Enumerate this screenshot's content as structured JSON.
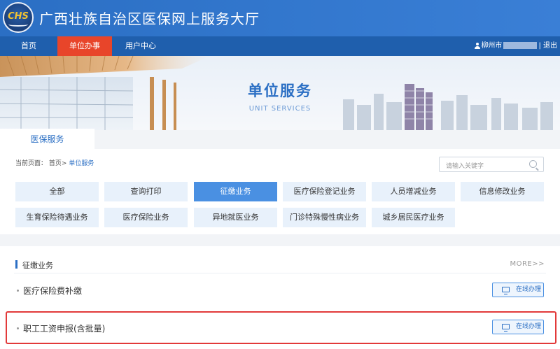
{
  "header": {
    "logo_text": "CHS",
    "title": "广西壮族自治区医保网上服务大厅"
  },
  "nav": {
    "items": [
      {
        "label": "首页"
      },
      {
        "label": "单位办事"
      },
      {
        "label": "用户中心"
      }
    ],
    "user_city": "柳州市",
    "separator": "|",
    "logout": "退出"
  },
  "banner": {
    "title": "单位服务",
    "subtitle": "UNIT SERVICES"
  },
  "tab": {
    "label": "医保服务"
  },
  "breadcrumb": {
    "prefix": "当前页面：",
    "home": "首页",
    "sep": ">",
    "current": "单位服务"
  },
  "search": {
    "placeholder": "请输入关键字"
  },
  "categories": [
    {
      "label": "全部"
    },
    {
      "label": "查询打印"
    },
    {
      "label": "征缴业务"
    },
    {
      "label": "医疗保险登记业务"
    },
    {
      "label": "人员增减业务"
    },
    {
      "label": "信息修改业务"
    },
    {
      "label": "生育保险待遇业务"
    },
    {
      "label": "医疗保险业务"
    },
    {
      "label": "异地就医业务"
    },
    {
      "label": "门诊特殊慢性病业务"
    },
    {
      "label": "城乡居民医疗业务"
    }
  ],
  "section": {
    "title": "征缴业务",
    "more": "MORE>>",
    "items": [
      {
        "label": "医疗保险费补缴",
        "action": "在线办理"
      },
      {
        "label": "职工工资申报(含批量)",
        "action": "在线办理"
      }
    ]
  },
  "colors": {
    "primary": "#2b6fc4",
    "nav": "#1f5fad",
    "active_nav": "#e8452a",
    "highlight": "#e23a3a"
  }
}
